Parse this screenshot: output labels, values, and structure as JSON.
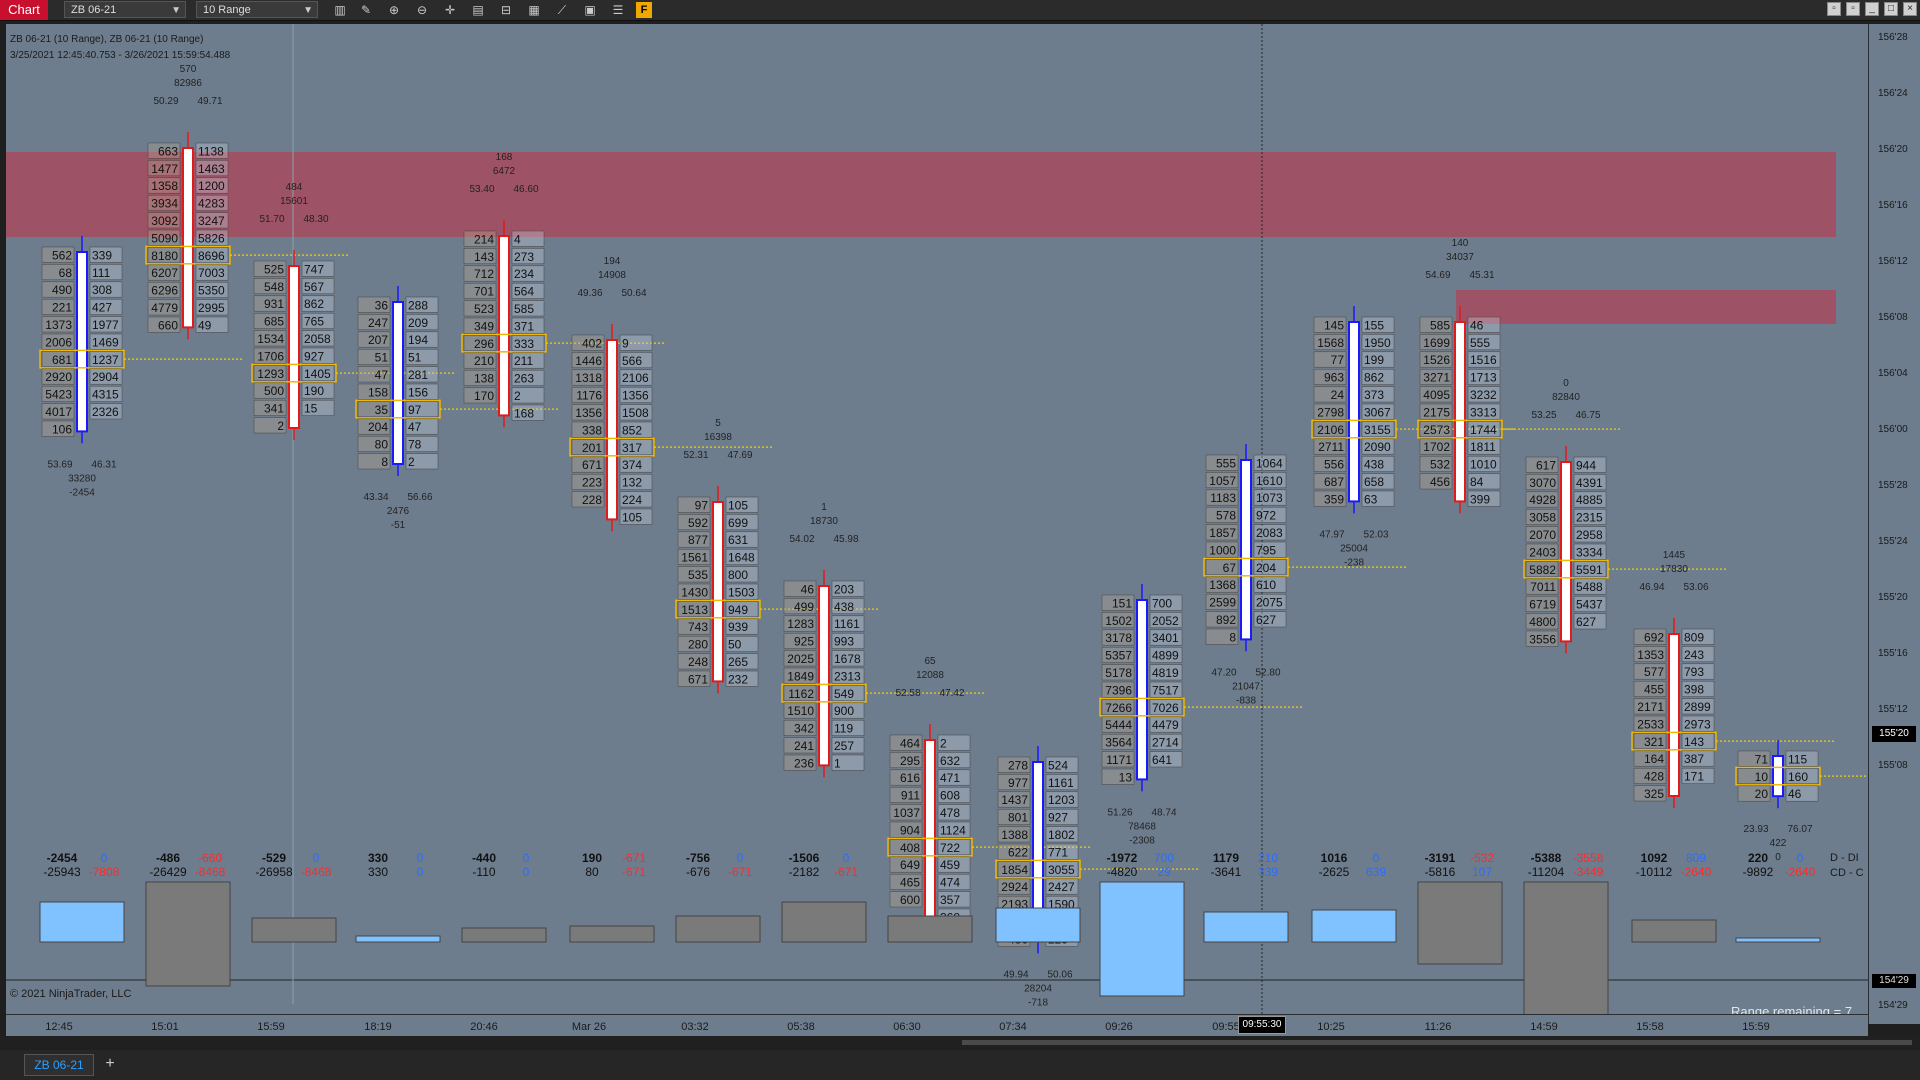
{
  "toolbar": {
    "chart_label": "Chart",
    "instrument": "ZB 06-21",
    "bar_type": "10 Range",
    "f_label": "F",
    "icons": [
      "bar-type-icon",
      "draw-tool-icon",
      "zoom-in-icon",
      "zoom-out-icon",
      "crosshair-icon",
      "data-box-icon",
      "chart-trader-icon",
      "indicators-icon",
      "strategies-icon",
      "properties-icon",
      "templates-icon"
    ]
  },
  "header": {
    "series_title": "ZB 06-21 (10 Range), ZB 06-21 (10 Range)",
    "date_range": "3/25/2021 12:45:40.753 - 3/26/2021 15:59:54.488"
  },
  "price_axis": {
    "labels": [
      "156'28",
      "156'24",
      "156'20",
      "156'16",
      "156'12",
      "156'08",
      "156'04",
      "156'00",
      "155'28",
      "155'24",
      "155'20",
      "155'16",
      "155'12",
      "155'08",
      "154'29"
    ],
    "current_price": "155'20",
    "cursor_price": "154'29"
  },
  "time_axis": {
    "labels": [
      "12:45",
      "15:01",
      "15:59",
      "18:19",
      "20:46",
      "Mar 26",
      "03:32",
      "05:38",
      "06:30",
      "07:34",
      "09:26",
      "09:55",
      "10:25",
      "11:26",
      "14:59",
      "15:58",
      "15:59"
    ],
    "cursor_time": "09:55:30"
  },
  "footer": {
    "copyright": "© 2021 NinjaTrader, LLC",
    "range_remaining": "Range remaining = 7",
    "row_label_1": "D - DI",
    "row_label_2": "CD - C"
  },
  "colors": {
    "chart_bg": "#6e7d8d",
    "zone": "#c43246",
    "up_bar": "#1a1aff",
    "down_bar": "#e01b1b",
    "poc_highlight": "#f0b800",
    "delta_pos": "#2a6dff",
    "delta_neg": "#ff2a2a"
  },
  "bars": [
    {
      "dir": "up",
      "stats_top": [],
      "stats_bottom": [
        "53.69",
        "46.31",
        "33280",
        "-2454"
      ],
      "left": [
        "562",
        "68",
        "490",
        "221",
        "1373",
        "2006",
        "681",
        "2920",
        "5423",
        "4017",
        "106"
      ],
      "right": [
        "339",
        "111",
        "308",
        "427",
        "1977",
        "1469",
        "1237",
        "2904",
        "4315",
        "2326"
      ],
      "delta": "-2454",
      "cum": "-25943",
      "d2": "0",
      "cd2": "-7808"
    },
    {
      "dir": "down",
      "stats_top": [
        "570",
        "82986",
        "50.29",
        "49.71"
      ],
      "stats_bottom": [],
      "left": [
        "663",
        "1477",
        "1358",
        "3934",
        "3092",
        "5090",
        "8180",
        "6207",
        "6296",
        "4779",
        "660"
      ],
      "right": [
        "1138",
        "1463",
        "1200",
        "4283",
        "3247",
        "5826",
        "8696",
        "7003",
        "5350",
        "2995",
        "49"
      ],
      "delta": "-486",
      "cum": "-26429",
      "d2": "-660",
      "cd2": "-8468"
    },
    {
      "dir": "down",
      "stats_top": [
        "484",
        "15601",
        "51.70",
        "48.30"
      ],
      "stats_bottom": [],
      "left": [
        "525",
        "548",
        "931",
        "685",
        "1534",
        "1706",
        "1293",
        "500",
        "341",
        "2"
      ],
      "right": [
        "747",
        "567",
        "862",
        "765",
        "2058",
        "927",
        "1405",
        "190",
        "15"
      ],
      "delta": "-529",
      "cum": "-26958",
      "d2": "0",
      "cd2": "-8468"
    },
    {
      "dir": "up",
      "stats_top": [],
      "stats_bottom": [
        "43.34",
        "56.66",
        "2476",
        "-51"
      ],
      "left": [
        "36",
        "247",
        "207",
        "51",
        "47",
        "158",
        "35",
        "204",
        "80",
        "8"
      ],
      "right": [
        "288",
        "209",
        "194",
        "51",
        "281",
        "156",
        "97",
        "47",
        "78",
        "2"
      ],
      "delta": "330",
      "cum": "330",
      "d2": "0",
      "cd2": "0"
    },
    {
      "dir": "down",
      "stats_top": [
        "168",
        "6472",
        "53.40",
        "46.60"
      ],
      "stats_bottom": [],
      "left": [
        "214",
        "143",
        "712",
        "701",
        "523",
        "349",
        "296",
        "210",
        "138",
        "170"
      ],
      "right": [
        "4",
        "273",
        "234",
        "564",
        "585",
        "371",
        "333",
        "211",
        "263",
        "2",
        "168"
      ],
      "delta": "-440",
      "cum": "-110",
      "d2": "0",
      "cd2": "0"
    },
    {
      "dir": "down",
      "stats_top": [
        "194",
        "14908",
        "49.36",
        "50.64"
      ],
      "stats_bottom": [],
      "left": [
        "402",
        "1446",
        "1318",
        "1176",
        "1356",
        "338",
        "201",
        "671",
        "223",
        "228"
      ],
      "right": [
        "9",
        "566",
        "2106",
        "1356",
        "1508",
        "852",
        "317",
        "374",
        "132",
        "224",
        "105"
      ],
      "delta": "190",
      "cum": "80",
      "d2": "-671",
      "cd2": "-671"
    },
    {
      "dir": "down",
      "stats_top": [
        "5",
        "16398",
        "52.31",
        "47.69"
      ],
      "stats_bottom": [],
      "left": [
        "97",
        "592",
        "877",
        "1561",
        "535",
        "1430",
        "1513",
        "743",
        "280",
        "248",
        "671"
      ],
      "right": [
        "105",
        "699",
        "631",
        "1648",
        "800",
        "1503",
        "949",
        "939",
        "50",
        "265",
        "232"
      ],
      "delta": "-756",
      "cum": "-676",
      "d2": "0",
      "cd2": "-671"
    },
    {
      "dir": "down",
      "stats_top": [
        "1",
        "18730",
        "54.02",
        "45.98"
      ],
      "stats_bottom": [],
      "left": [
        "46",
        "499",
        "1283",
        "925",
        "2025",
        "1849",
        "1162",
        "1510",
        "342",
        "241",
        "236"
      ],
      "right": [
        "203",
        "438",
        "1161",
        "993",
        "1678",
        "2313",
        "549",
        "900",
        "119",
        "257",
        "1"
      ],
      "delta": "-1506",
      "cum": "-2182",
      "d2": "0",
      "cd2": "-671"
    },
    {
      "dir": "down",
      "stats_top": [
        "65",
        "12088",
        "52.58",
        "47.42"
      ],
      "stats_bottom": [],
      "left": [
        "464",
        "295",
        "616",
        "911",
        "1037",
        "904",
        "408",
        "649",
        "465",
        "600"
      ],
      "right": [
        "2",
        "632",
        "471",
        "608",
        "478",
        "1124",
        "722",
        "459",
        "474",
        "357",
        "368"
      ],
      "delta": "",
      "cum": "",
      "d2": "",
      "cd2": ""
    },
    {
      "dir": "up",
      "stats_top": [],
      "stats_bottom": [
        "49.94",
        "50.06",
        "28204",
        "-718"
      ],
      "left": [
        "278",
        "977",
        "1437",
        "801",
        "1388",
        "622",
        "1854",
        "2924",
        "2193",
        "1126",
        "486"
      ],
      "right": [
        "524",
        "1161",
        "1203",
        "927",
        "1802",
        "771",
        "3055",
        "2427",
        "1590",
        "433",
        "225"
      ],
      "delta": "",
      "cum": "",
      "d2": "",
      "cd2": ""
    },
    {
      "dir": "up",
      "stats_top": [],
      "stats_bottom": [
        "51.26",
        "48.74",
        "78468",
        "-2308"
      ],
      "left": [
        "151",
        "1502",
        "3178",
        "5357",
        "5178",
        "7396",
        "7266",
        "5444",
        "3564",
        "1171",
        "13"
      ],
      "right": [
        "700",
        "2052",
        "3401",
        "4899",
        "4819",
        "7517",
        "7026",
        "4479",
        "2714",
        "641"
      ],
      "delta": "-1972",
      "cum": "-4820",
      "d2": "700",
      "cd2": "29"
    },
    {
      "dir": "up",
      "stats_top": [],
      "stats_bottom": [
        "47.20",
        "52.80",
        "21047",
        "-838"
      ],
      "left": [
        "555",
        "1057",
        "1183",
        "578",
        "1857",
        "1000",
        "67",
        "1368",
        "2599",
        "892",
        "8"
      ],
      "right": [
        "1064",
        "1610",
        "1073",
        "972",
        "2083",
        "795",
        "204",
        "610",
        "2075",
        "627"
      ],
      "delta": "1179",
      "cum": "-3641",
      "d2": "210",
      "cd2": "339"
    },
    {
      "dir": "up",
      "stats_top": [],
      "stats_bottom": [
        "47.97",
        "52.03",
        "25004",
        "-238"
      ],
      "left": [
        "145",
        "1568",
        "77",
        "963",
        "24",
        "2798",
        "2106",
        "2711",
        "556",
        "687",
        "359"
      ],
      "right": [
        "155",
        "1950",
        "199",
        "862",
        "373",
        "3067",
        "3155",
        "2090",
        "438",
        "658",
        "63"
      ],
      "delta": "1016",
      "cum": "-2625",
      "d2": "0",
      "cd2": "639"
    },
    {
      "dir": "down",
      "stats_top": [
        "140",
        "34037",
        "54.69",
        "45.31"
      ],
      "stats_bottom": [],
      "left": [
        "585",
        "1699",
        "1526",
        "3271",
        "4095",
        "2175",
        "2573",
        "1702",
        "532",
        "456"
      ],
      "right": [
        "46",
        "555",
        "1516",
        "1713",
        "3232",
        "3313",
        "1744",
        "1811",
        "1010",
        "84",
        "399"
      ],
      "delta": "-3191",
      "cum": "-5816",
      "d2": "-532",
      "cd2": "107"
    },
    {
      "dir": "down",
      "stats_top": [
        "0",
        "82840",
        "53.25",
        "46.75"
      ],
      "stats_bottom": [],
      "left": [
        "617",
        "3070",
        "4928",
        "3058",
        "2070",
        "2403",
        "5882",
        "7011",
        "6719",
        "4800",
        "3556"
      ],
      "right": [
        "944",
        "4391",
        "4885",
        "2315",
        "2958",
        "3334",
        "5591",
        "5488",
        "5437",
        "627"
      ],
      "delta": "-5388",
      "cum": "-11204",
      "d2": "-3558",
      "cd2": "-3449"
    },
    {
      "dir": "down",
      "stats_top": [
        "1445",
        "17830",
        "46.94",
        "53.06"
      ],
      "stats_bottom": [],
      "left": [
        "692",
        "1353",
        "577",
        "455",
        "2171",
        "2533",
        "321",
        "164",
        "428",
        "325"
      ],
      "right": [
        "809",
        "243",
        "793",
        "398",
        "2899",
        "2973",
        "143",
        "387",
        "171"
      ],
      "delta": "1092",
      "cum": "-10112",
      "d2": "809",
      "cd2": "-2640"
    },
    {
      "dir": "up",
      "stats_top": [],
      "stats_bottom": [
        "23.93",
        "76.07",
        "422",
        "0"
      ],
      "left": [
        "71",
        "10",
        "20"
      ],
      "right": [
        "115",
        "160",
        "46"
      ],
      "delta": "220",
      "cum": "-9892",
      "d2": "0",
      "cd2": "-2640"
    }
  ]
}
